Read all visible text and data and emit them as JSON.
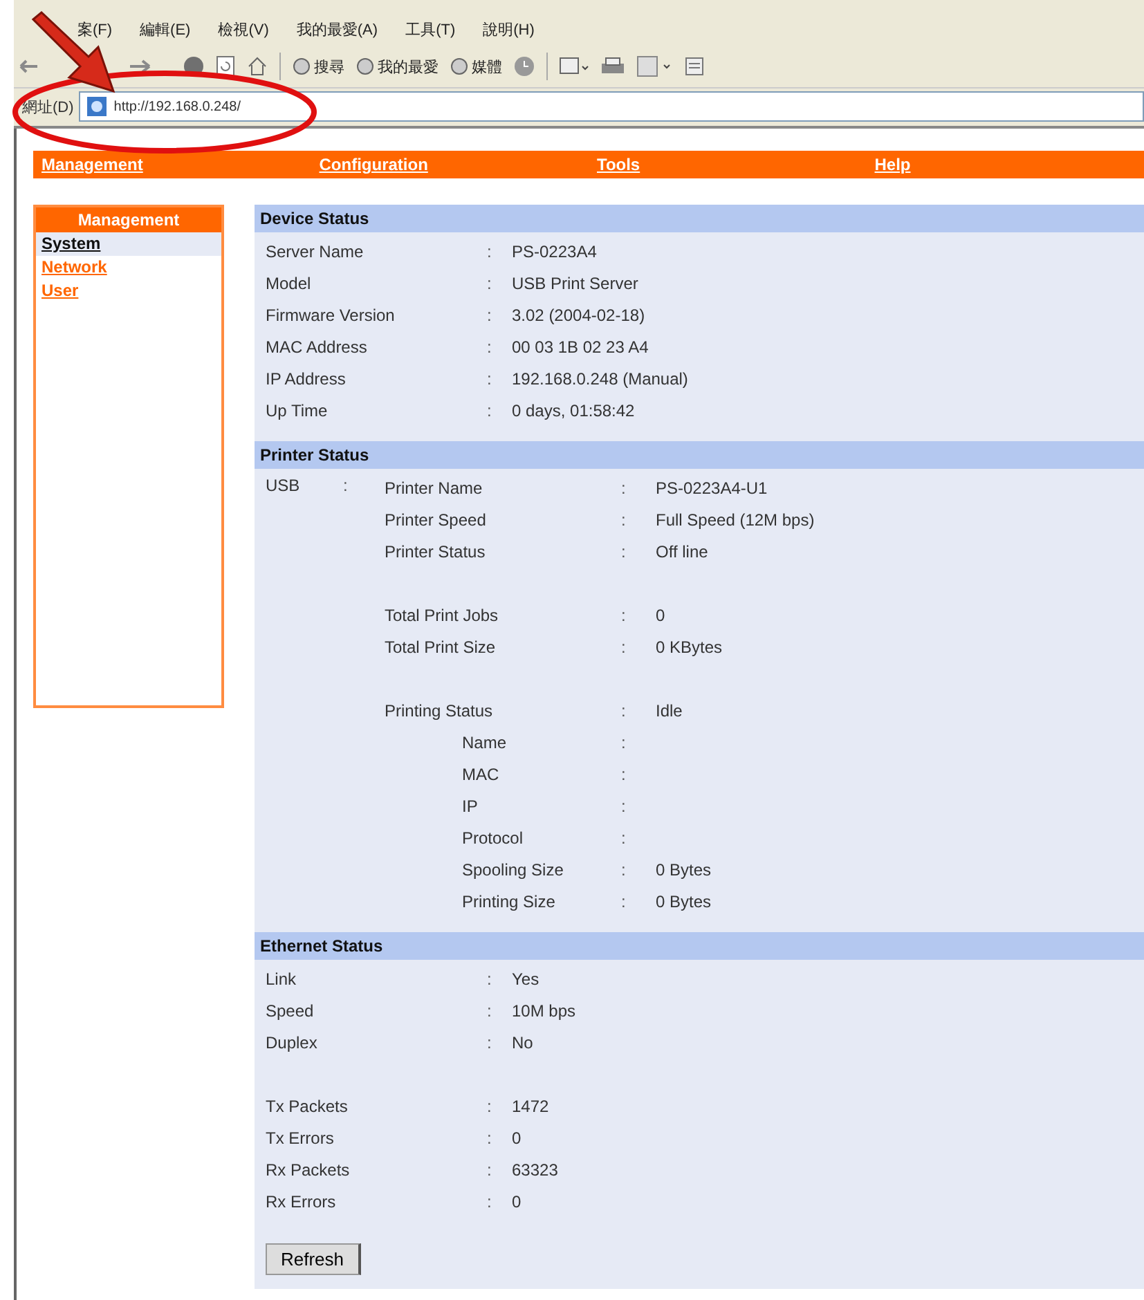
{
  "browser": {
    "menu": [
      "案(F)",
      "編輯(E)",
      "檢視(V)",
      "我的最愛(A)",
      "工具(T)",
      "說明(H)"
    ],
    "toolbar": [
      "搜尋",
      "我的最愛",
      "媒體"
    ],
    "address_label": "網址(D)",
    "url": "http://192.168.0.248/"
  },
  "nav": [
    "Management",
    "Configuration",
    "Tools",
    "Help"
  ],
  "sidebar": {
    "title": "Management",
    "items": [
      {
        "label": "System",
        "selected": true
      },
      {
        "label": "Network",
        "selected": false
      },
      {
        "label": "User",
        "selected": false
      }
    ]
  },
  "device_status": {
    "title": "Device Status",
    "separator": ":",
    "rows": [
      {
        "label": "Server Name",
        "value": "PS-0223A4"
      },
      {
        "label": "Model",
        "value": "USB Print Server"
      },
      {
        "label": "Firmware Version",
        "value": "3.02 (2004-02-18)"
      },
      {
        "label": "MAC Address",
        "value": "00 03 1B 02 23 A4"
      },
      {
        "label": "IP Address",
        "value": "192.168.0.248 (Manual)"
      },
      {
        "label": "Up Time",
        "value": "0 days, 01:58:42"
      }
    ]
  },
  "printer_status": {
    "title": "Printer Status",
    "port": "USB",
    "separator": ":",
    "groups": [
      [
        {
          "kind": "item",
          "label": "Printer Name",
          "value": "PS-0223A4-U1"
        },
        {
          "kind": "item",
          "label": "Printer Speed",
          "value": "Full Speed (12M bps)"
        },
        {
          "kind": "item",
          "label": "Printer Status",
          "value": "Off line"
        }
      ],
      [
        {
          "kind": "item",
          "label": "Total Print Jobs",
          "value": "0"
        },
        {
          "kind": "item",
          "label": "Total Print Size",
          "value": "0 KBytes"
        }
      ],
      [
        {
          "kind": "item",
          "label": "Printing Status",
          "value": "Idle"
        },
        {
          "kind": "sub",
          "label": "Name"
        },
        {
          "kind": "sub",
          "label": "MAC"
        },
        {
          "kind": "sub",
          "label": "IP"
        },
        {
          "kind": "sub",
          "label": "Protocol"
        },
        {
          "kind": "sub",
          "label": "Spooling Size",
          "value": "0 Bytes"
        },
        {
          "kind": "sub",
          "label": "Printing Size",
          "value": "0 Bytes"
        }
      ]
    ]
  },
  "ethernet_status": {
    "title": "Ethernet Status",
    "separator": ":",
    "groups": [
      [
        {
          "label": "Link",
          "value": "Yes"
        },
        {
          "label": "Speed",
          "value": "10M bps"
        },
        {
          "label": "Duplex",
          "value": "No"
        }
      ],
      [
        {
          "label": "Tx Packets",
          "value": "1472"
        },
        {
          "label": "Tx Errors",
          "value": "0"
        },
        {
          "label": "Rx Packets",
          "value": "63323"
        },
        {
          "label": "Rx Errors",
          "value": "0"
        }
      ]
    ]
  },
  "refresh_button": "Refresh"
}
